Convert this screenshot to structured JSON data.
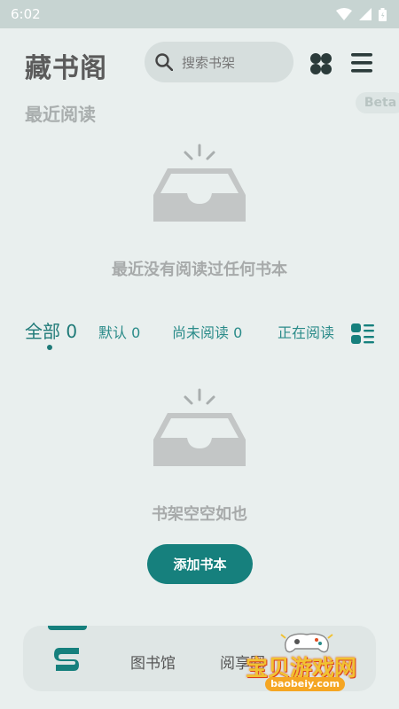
{
  "status_bar": {
    "time": "6:02"
  },
  "header": {
    "title": "藏书阁",
    "search_placeholder": "搜索书架"
  },
  "beta_badge": "Beta",
  "recent": {
    "title": "最近阅读",
    "empty_text": "最近没有阅读过任何书本"
  },
  "tabs": [
    {
      "label": "全部 0",
      "active": true
    },
    {
      "label": "默认 0",
      "active": false
    },
    {
      "label": "尚未阅读 0",
      "active": false
    },
    {
      "label": "正在阅读",
      "active": false
    }
  ],
  "shelf": {
    "empty_text": "书架空空如也",
    "add_button": "添加书本"
  },
  "bottom_nav": {
    "items": [
      {
        "label": "图书馆"
      },
      {
        "label": "阅享圈"
      }
    ]
  },
  "watermark": {
    "text": "宝贝游戏网",
    "url": "baobeiy.com"
  },
  "colors": {
    "accent": "#16807d",
    "background": "#e9efee",
    "status_bar": "#c7d4d2"
  }
}
